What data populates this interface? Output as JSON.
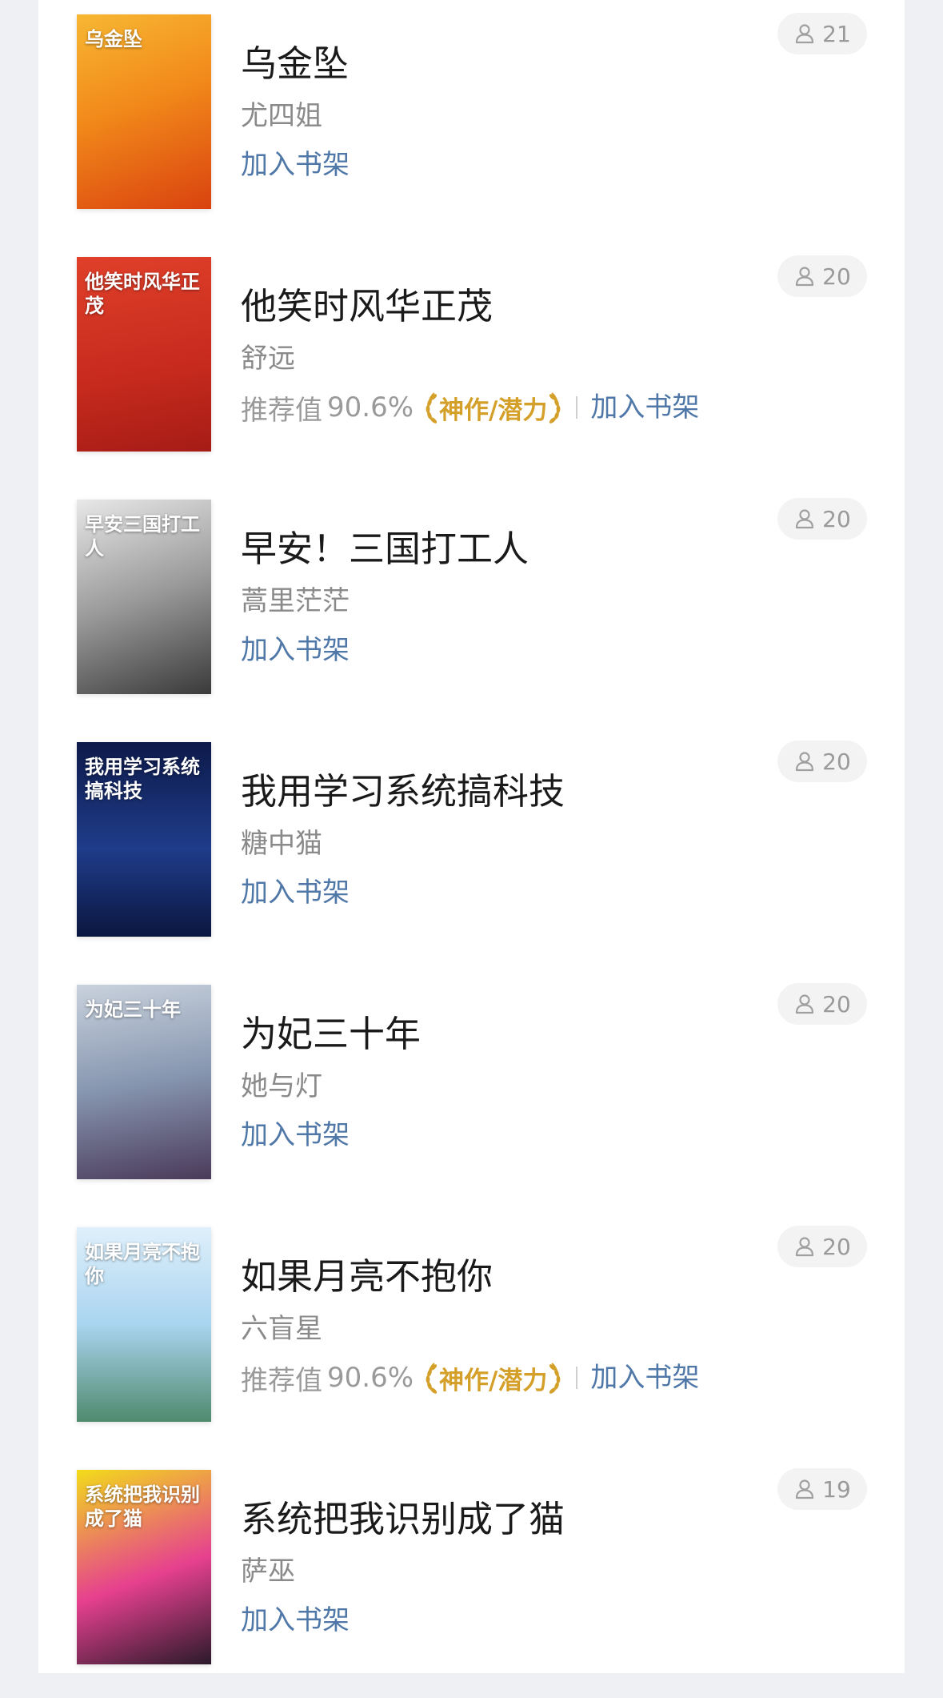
{
  "books": [
    {
      "title": "乌金坠",
      "author": "尤四姐",
      "readers": "21",
      "add_label": "加入书架",
      "has_rec": false,
      "cover": {
        "text": "乌金坠",
        "bg": "linear-gradient(160deg,#f7b733 0%,#f28a1a 45%,#d9420f 100%)"
      }
    },
    {
      "title": "他笑时风华正茂",
      "author": "舒远",
      "readers": "20",
      "add_label": "加入书架",
      "has_rec": true,
      "rec_label": "推荐值",
      "rec_value": "90.6%",
      "badge": "神作/潜力",
      "cover": {
        "text": "他笑时风华正茂",
        "bg": "linear-gradient(170deg,#e0402a 0%,#c62a1d 60%,#a51c16 100%)"
      }
    },
    {
      "title": "早安！三国打工人",
      "author": "蒿里茫茫",
      "readers": "20",
      "add_label": "加入书架",
      "has_rec": false,
      "cover": {
        "text": "早安三国打工人",
        "bg": "linear-gradient(160deg,#e8e8e8 0%,#9a9a9a 50%,#3a3a3a 100%)"
      }
    },
    {
      "title": "我用学习系统搞科技",
      "author": "糖中猫",
      "readers": "20",
      "add_label": "加入书架",
      "has_rec": false,
      "cover": {
        "text": "我用学习系统搞科技",
        "bg": "linear-gradient(180deg,#0d1a4a 0%,#1f3c8a 55%,#0b163f 100%)"
      }
    },
    {
      "title": "为妃三十年",
      "author": "她与灯",
      "readers": "20",
      "add_label": "加入书架",
      "has_rec": false,
      "cover": {
        "text": "为妃三十年",
        "bg": "linear-gradient(170deg,#c9d2dd 0%,#8796b0 50%,#4a3a5a 100%)"
      }
    },
    {
      "title": "如果月亮不抱你",
      "author": "六盲星",
      "readers": "20",
      "add_label": "加入书架",
      "has_rec": true,
      "rec_label": "推荐值",
      "rec_value": "90.6%",
      "badge": "神作/潜力",
      "cover": {
        "text": "如果月亮不抱你",
        "bg": "linear-gradient(180deg,#dff0fb 0%,#a9d4ef 50%,#4f8a6e 100%)"
      }
    },
    {
      "title": "系统把我识别成了猫",
      "author": "萨巫",
      "readers": "19",
      "add_label": "加入书架",
      "has_rec": false,
      "cover": {
        "text": "系统把我识别成了猫",
        "bg": "linear-gradient(160deg,#f2dc1a 0%,#e6408f 55%,#2a1a2a 100%)"
      }
    }
  ],
  "colors": {
    "link": "#4f78a8",
    "badge": "#d4a02a",
    "title": "#1a1a1a",
    "muted": "#8a8a8a"
  },
  "icons": {
    "readers": "person-outline-icon",
    "laurel": "laurel-icon"
  }
}
